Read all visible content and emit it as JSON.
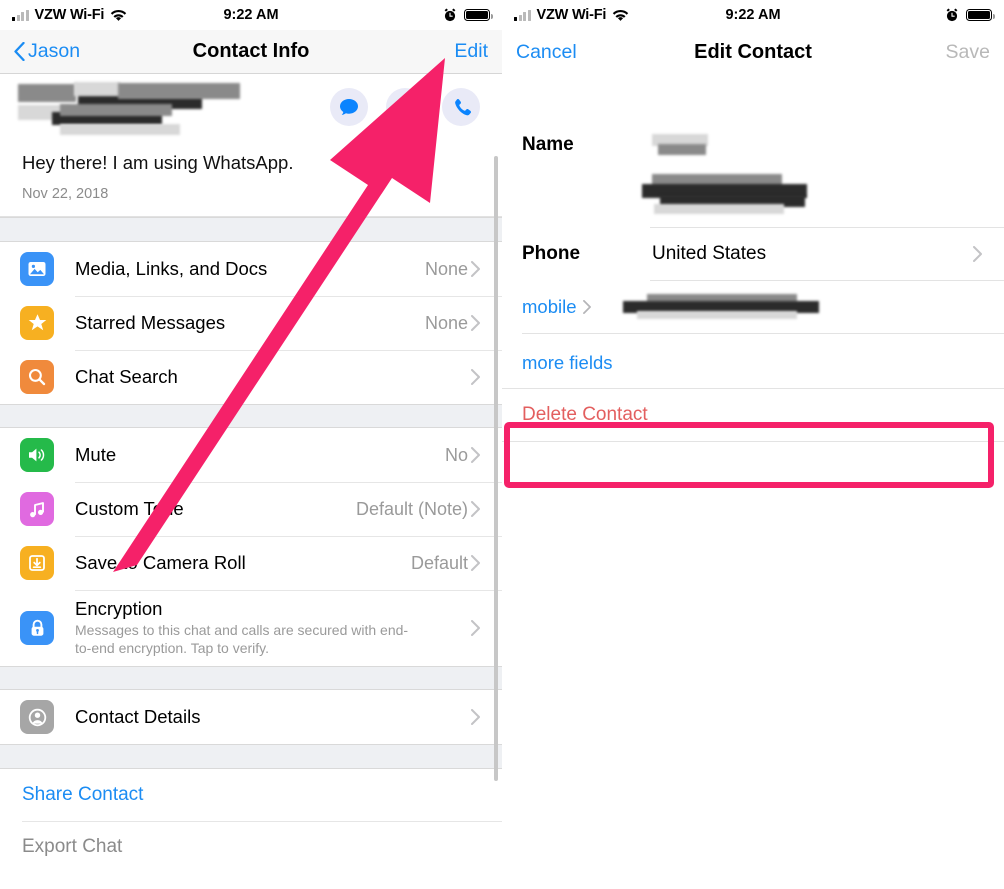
{
  "status_bar": {
    "carrier": "VZW Wi-Fi",
    "time": "9:22 AM",
    "signal_icon": "signal-bars-icon",
    "wifi_icon": "wifi-icon",
    "alarm_icon": "alarm-clock-icon",
    "battery_icon": "battery-full-icon"
  },
  "left_panel": {
    "nav": {
      "back_label": "Jason",
      "back_icon": "chevron-left-icon",
      "title": "Contact Info",
      "edit_label": "Edit"
    },
    "profile": {
      "name_redacted": true,
      "status_message": "Hey there! I am using WhatsApp.",
      "status_date": "Nov 22, 2018",
      "actions": [
        {
          "name": "message-action-button",
          "icon": "chat-bubble-icon"
        },
        {
          "name": "video-call-action-button",
          "icon": "video-camera-icon"
        },
        {
          "name": "voice-call-action-button",
          "icon": "phone-icon"
        }
      ]
    },
    "sections": [
      {
        "rows": [
          {
            "label": "Media, Links, and Docs",
            "value": "None",
            "icon": "photo-icon",
            "icon_color": "#3a93f7",
            "chevron": true
          },
          {
            "label": "Starred Messages",
            "value": "None",
            "icon": "star-icon",
            "icon_color": "#f7b021",
            "chevron": true
          },
          {
            "label": "Chat Search",
            "value": "",
            "icon": "search-icon",
            "icon_color": "#f08a3c",
            "chevron": true
          }
        ]
      },
      {
        "rows": [
          {
            "label": "Mute",
            "value": "No",
            "icon": "speaker-icon",
            "icon_color": "#25ba4a",
            "chevron": true
          },
          {
            "label": "Custom Tone",
            "value": "Default (Note)",
            "icon": "music-note-icon",
            "icon_color": "#e06ae0",
            "chevron": true
          },
          {
            "label": "Save to Camera Roll",
            "value": "Default",
            "icon": "download-icon",
            "icon_color": "#f7b021",
            "chevron": true
          },
          {
            "label": "Encryption",
            "value": "",
            "sub": "Messages to this chat and calls are secured with end-to-end encryption. Tap to verify.",
            "icon": "lock-icon",
            "icon_color": "#3a93f7",
            "chevron": true
          }
        ]
      },
      {
        "rows": [
          {
            "label": "Contact Details",
            "value": "",
            "icon": "person-circle-icon",
            "icon_color": "#a6a6a6",
            "chevron": true
          }
        ]
      }
    ],
    "footer_links": [
      {
        "label": "Share Contact",
        "style": "link"
      },
      {
        "label": "Export Chat",
        "style": "dim"
      }
    ]
  },
  "right_panel": {
    "nav": {
      "cancel_label": "Cancel",
      "title": "Edit Contact",
      "save_label": "Save",
      "save_enabled": false
    },
    "form": {
      "name_label": "Name",
      "name_value_redacted": true,
      "phone_label": "Phone",
      "phone_country": "United States",
      "phone_chevron_icon": "chevron-right-icon",
      "mobile_label": "mobile",
      "mobile_chevron_icon": "chevron-right-icon",
      "mobile_number_redacted": true,
      "more_fields_label": "more fields",
      "delete_label": "Delete Contact"
    }
  },
  "annotations": {
    "arrow": {
      "color": "#f52169",
      "points_to": "Edit",
      "name": "pink-annotation-arrow"
    },
    "highlight_box": {
      "color": "#f52169",
      "target": "Delete Contact",
      "name": "delete-contact-highlight-box"
    }
  },
  "colors": {
    "ios_blue": "#1b8cf3",
    "annotation_pink": "#f52169",
    "destructive_red": "#e35f5f",
    "nav_bg": "#f7f7f7",
    "group_band": "#eef0f3"
  }
}
